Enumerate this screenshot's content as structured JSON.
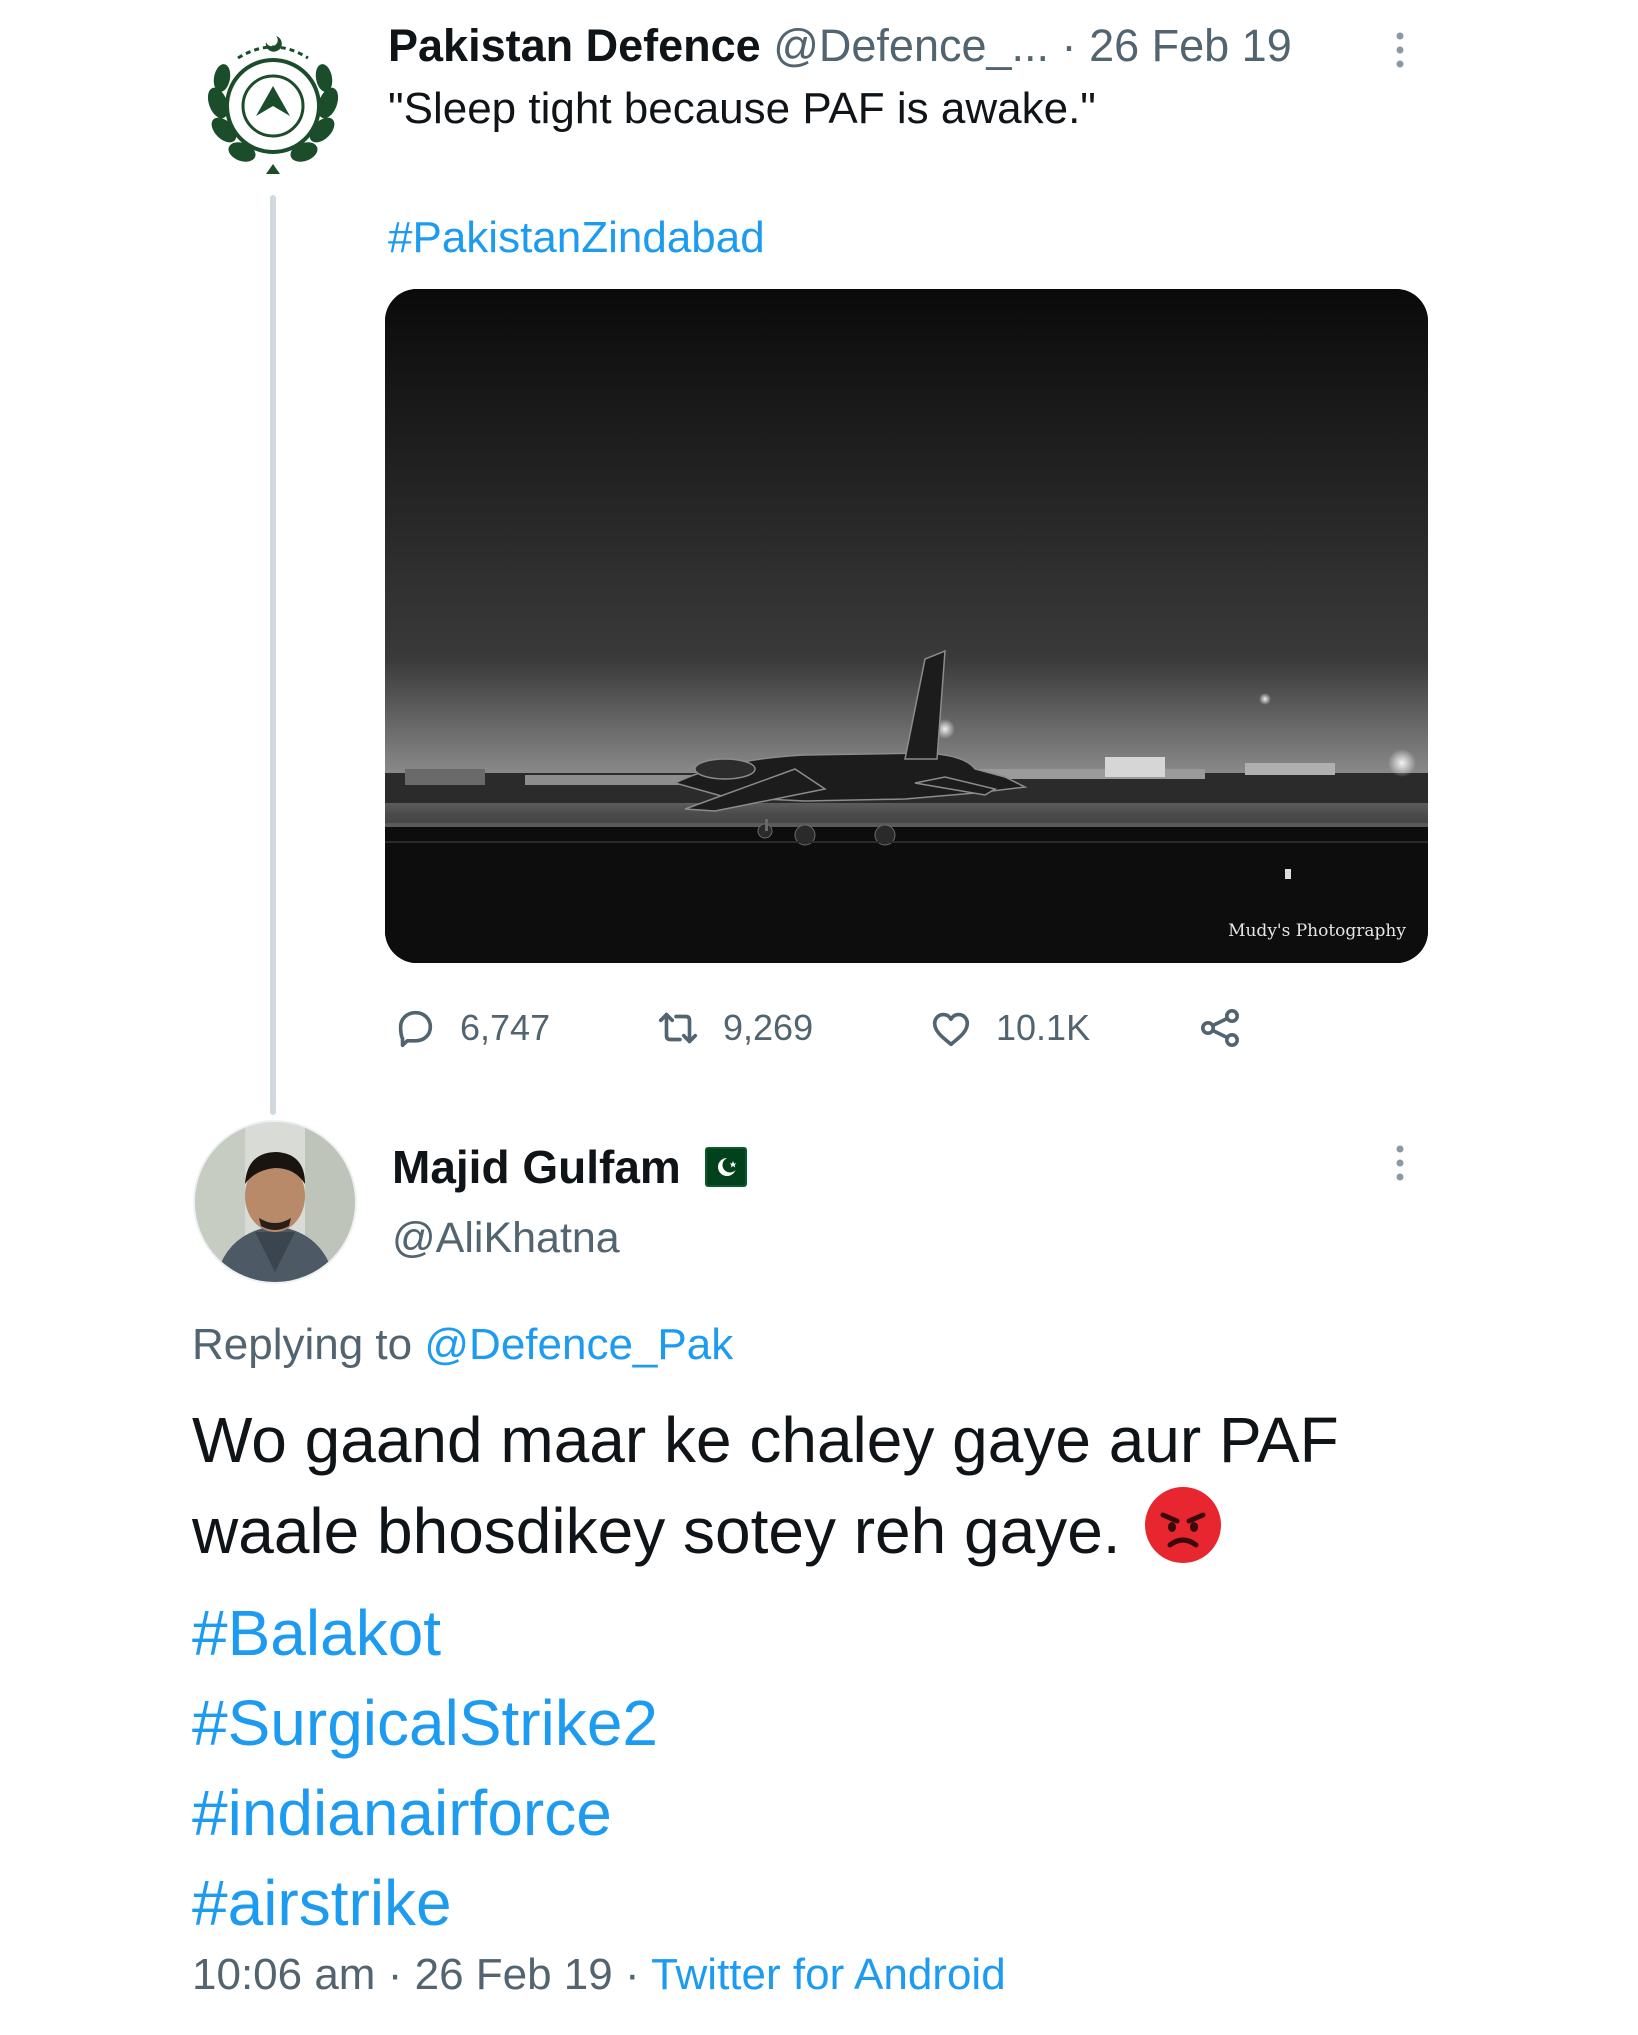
{
  "colors": {
    "link": "#1d9bf0",
    "muted": "#536471",
    "text": "#0f1419",
    "thread_line": "#cfd9de",
    "flag_green": "#01411c",
    "emoji_red": "#e8262f"
  },
  "tweet": {
    "author_name": "Pakistan Defence",
    "author_handle": "@Defence_...",
    "separator": "·",
    "date": "26 Feb 19",
    "text": "\"Sleep tight because PAF is awake.\"",
    "hashtag": "#PakistanZindabad",
    "media": {
      "watermark": "Mudy's Photography"
    },
    "actions": {
      "replies": "6,747",
      "retweets": "9,269",
      "likes": "10.1K"
    },
    "icons": [
      "more-options-icon",
      "reply-icon",
      "retweet-icon",
      "like-icon",
      "share-icon"
    ]
  },
  "reply": {
    "author_name": "Majid Gulfam",
    "author_handle": "@AliKhatna",
    "replying_label": "Replying to",
    "replying_handle": "@Defence_Pak",
    "text_line1": "Wo gaand maar ke chaley gaye aur PAF",
    "text_line2": "waale bhosdikey sotey reh gaye.",
    "emoji": "angry-face-icon",
    "hashtags": [
      "#Balakot",
      "#SurgicalStrike2",
      "#indianairforce",
      "#airstrike"
    ],
    "time": "10:06 am",
    "separator": "·",
    "date": "26 Feb 19",
    "source": "Twitter for Android"
  }
}
